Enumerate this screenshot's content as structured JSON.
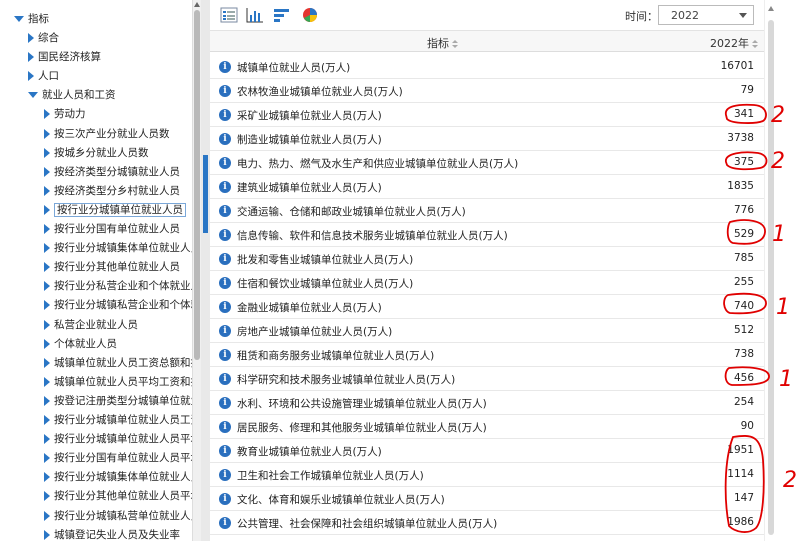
{
  "tree": {
    "root_label": "指标",
    "items": [
      {
        "label": "综合",
        "level": 1,
        "expanded": false
      },
      {
        "label": "国民经济核算",
        "level": 1,
        "expanded": false
      },
      {
        "label": "人口",
        "level": 1,
        "expanded": false
      },
      {
        "label": "就业人员和工资",
        "level": 1,
        "expanded": true
      },
      {
        "label": "劳动力",
        "level": 2
      },
      {
        "label": "按三次产业分就业人员数",
        "level": 2
      },
      {
        "label": "按城乡分就业人员数",
        "level": 2
      },
      {
        "label": "按经济类型分城镇就业人员",
        "level": 2
      },
      {
        "label": "按经济类型分乡村就业人员",
        "level": 2
      },
      {
        "label": "按行业分城镇单位就业人员",
        "level": 2,
        "selected": true
      },
      {
        "label": "按行业分国有单位就业人员",
        "level": 2
      },
      {
        "label": "按行业分城镇集体单位就业人员",
        "level": 2
      },
      {
        "label": "按行业分其他单位就业人员",
        "level": 2
      },
      {
        "label": "按行业分私营企业和个体就业人",
        "level": 2
      },
      {
        "label": "按行业分城镇私营企业和个体就",
        "level": 2
      },
      {
        "label": "私营企业就业人员",
        "level": 2
      },
      {
        "label": "个体就业人员",
        "level": 2
      },
      {
        "label": "城镇单位就业人员工资总额和指",
        "level": 2
      },
      {
        "label": "城镇单位就业人员平均工资和指",
        "level": 2
      },
      {
        "label": "按登记注册类型分城镇单位就业",
        "level": 2
      },
      {
        "label": "按行业分城镇单位就业人员工资",
        "level": 2
      },
      {
        "label": "按行业分城镇单位就业人员平均",
        "level": 2
      },
      {
        "label": "按行业分国有单位就业人员平均",
        "level": 2
      },
      {
        "label": "按行业分城镇集体单位就业人员",
        "level": 2
      },
      {
        "label": "按行业分其他单位就业人员平均",
        "level": 2
      },
      {
        "label": "按行业分城镇私营单位就业人员",
        "level": 2
      },
      {
        "label": "城镇登记失业人员及失业率",
        "level": 2
      }
    ]
  },
  "toolbar": {
    "icons": [
      "table-view-icon",
      "bar-chart-icon",
      "horizontal-bar-icon",
      "pie-chart-icon"
    ],
    "time_label": "时间：",
    "time_value": "2022"
  },
  "table": {
    "col_indicator": "指标",
    "col_year": "2022年",
    "rows": [
      {
        "name": "城镇单位就业人员(万人)",
        "value": "16701"
      },
      {
        "name": "农林牧渔业城镇单位就业人员(万人)",
        "value": "79"
      },
      {
        "name": "采矿业城镇单位就业人员(万人)",
        "value": "341"
      },
      {
        "name": "制造业城镇单位就业人员(万人)",
        "value": "3738"
      },
      {
        "name": "电力、热力、燃气及水生产和供应业城镇单位就业人员(万人)",
        "value": "375"
      },
      {
        "name": "建筑业城镇单位就业人员(万人)",
        "value": "1835"
      },
      {
        "name": "交通运输、仓储和邮政业城镇单位就业人员(万人)",
        "value": "776"
      },
      {
        "name": "信息传输、软件和信息技术服务业城镇单位就业人员(万人)",
        "value": "529"
      },
      {
        "name": "批发和零售业城镇单位就业人员(万人)",
        "value": "785"
      },
      {
        "name": "住宿和餐饮业城镇单位就业人员(万人)",
        "value": "255"
      },
      {
        "name": "金融业城镇单位就业人员(万人)",
        "value": "740"
      },
      {
        "name": "房地产业城镇单位就业人员(万人)",
        "value": "512"
      },
      {
        "name": "租赁和商务服务业城镇单位就业人员(万人)",
        "value": "738"
      },
      {
        "name": "科学研究和技术服务业城镇单位就业人员(万人)",
        "value": "456"
      },
      {
        "name": "水利、环境和公共设施管理业城镇单位就业人员(万人)",
        "value": "254"
      },
      {
        "name": "居民服务、修理和其他服务业城镇单位就业人员(万人)",
        "value": "90"
      },
      {
        "name": "教育业城镇单位就业人员(万人)",
        "value": "1951"
      },
      {
        "name": "卫生和社会工作城镇单位就业人员(万人)",
        "value": "1114"
      },
      {
        "name": "文化、体育和娱乐业城镇单位就业人员(万人)",
        "value": "147"
      },
      {
        "name": "公共管理、社会保障和社会组织城镇单位就业人员(万人)",
        "value": "1986"
      }
    ]
  },
  "annotations": {
    "color": "#e00000",
    "marks": [
      "2",
      "2",
      "1",
      "1",
      "1",
      "2"
    ]
  }
}
